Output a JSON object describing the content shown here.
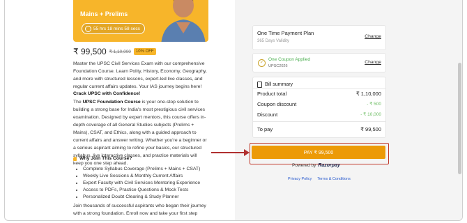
{
  "course": {
    "banner_title": "Mains + Prelims",
    "timer": "55 hrs 18 mins 58 secs",
    "price_now": "₹ 99,500",
    "price_was": "₹ 1,10,000",
    "discount_badge": "10% OFF",
    "intro": "Master the UPSC Civil Services Exam with our comprehensive Foundation Course. Learn Polity, History, Economy, Geography, and more with structured lessons, expert-led live classes, and regular current affairs updates. Your IAS journey begins here!",
    "confidence_heading": "Crack UPSC with Confidence!",
    "body_lead": "The",
    "body_bold": "UPSC Foundation Course",
    "body_rest": "is your one-stop solution to building a strong base for India's most prestigious civil services examination. Designed by expert mentors, this course offers in-depth coverage of all General Studies subjects (Prelims + Mains), CSAT, and Ethics, along with a guided approach to current affairs and answer writing. Whether you're a beginner or a serious aspirant aiming to refine your basics, our structured syllabus, live interactive classes, and practice materials will keep you one step ahead.",
    "why_heading": "Why Join This Course?",
    "bullets": [
      "Complete Syllabus Coverage (Prelims + Mains + CSAT)",
      "Weekly Live Sessions & Monthly Current Affairs",
      "Expert Faculty with Civil Services Mentoring Experience",
      "Access to PDFs, Practice Questions & Mock Tests",
      "Personalized Doubt Clearing & Study Planner"
    ],
    "outro": "Join thousands of successful aspirants who began their journey with a strong foundation. Enroll now and take your first step"
  },
  "checkout": {
    "plan_title": "One Time Payment Plan",
    "plan_validity": "365 Days Validity",
    "change_label": "Change",
    "coupon_status": "One Coupon Applied",
    "coupon_code": "UPSC2026",
    "bill_heading": "Bill summary",
    "rows": [
      {
        "label": "Product total",
        "value": "₹ 1,10,000"
      },
      {
        "label": "Coupon discount",
        "value": "- ₹ 500"
      },
      {
        "label": "Discount",
        "value": "- ₹ 10,000"
      }
    ],
    "to_pay_label": "To pay",
    "to_pay_value": "₹ 99,500",
    "pay_button": "PAY ₹ 99,500",
    "powered_by": "Powered by",
    "razorpay": "Razorpay",
    "privacy_link": "Privacy Policy",
    "terms_link": "Terms & Conditions"
  },
  "colors": {
    "accent": "#ec9a07",
    "banner": "#f7b52a",
    "highlight_border": "#c0392b",
    "coupon_green": "#4caf50"
  }
}
